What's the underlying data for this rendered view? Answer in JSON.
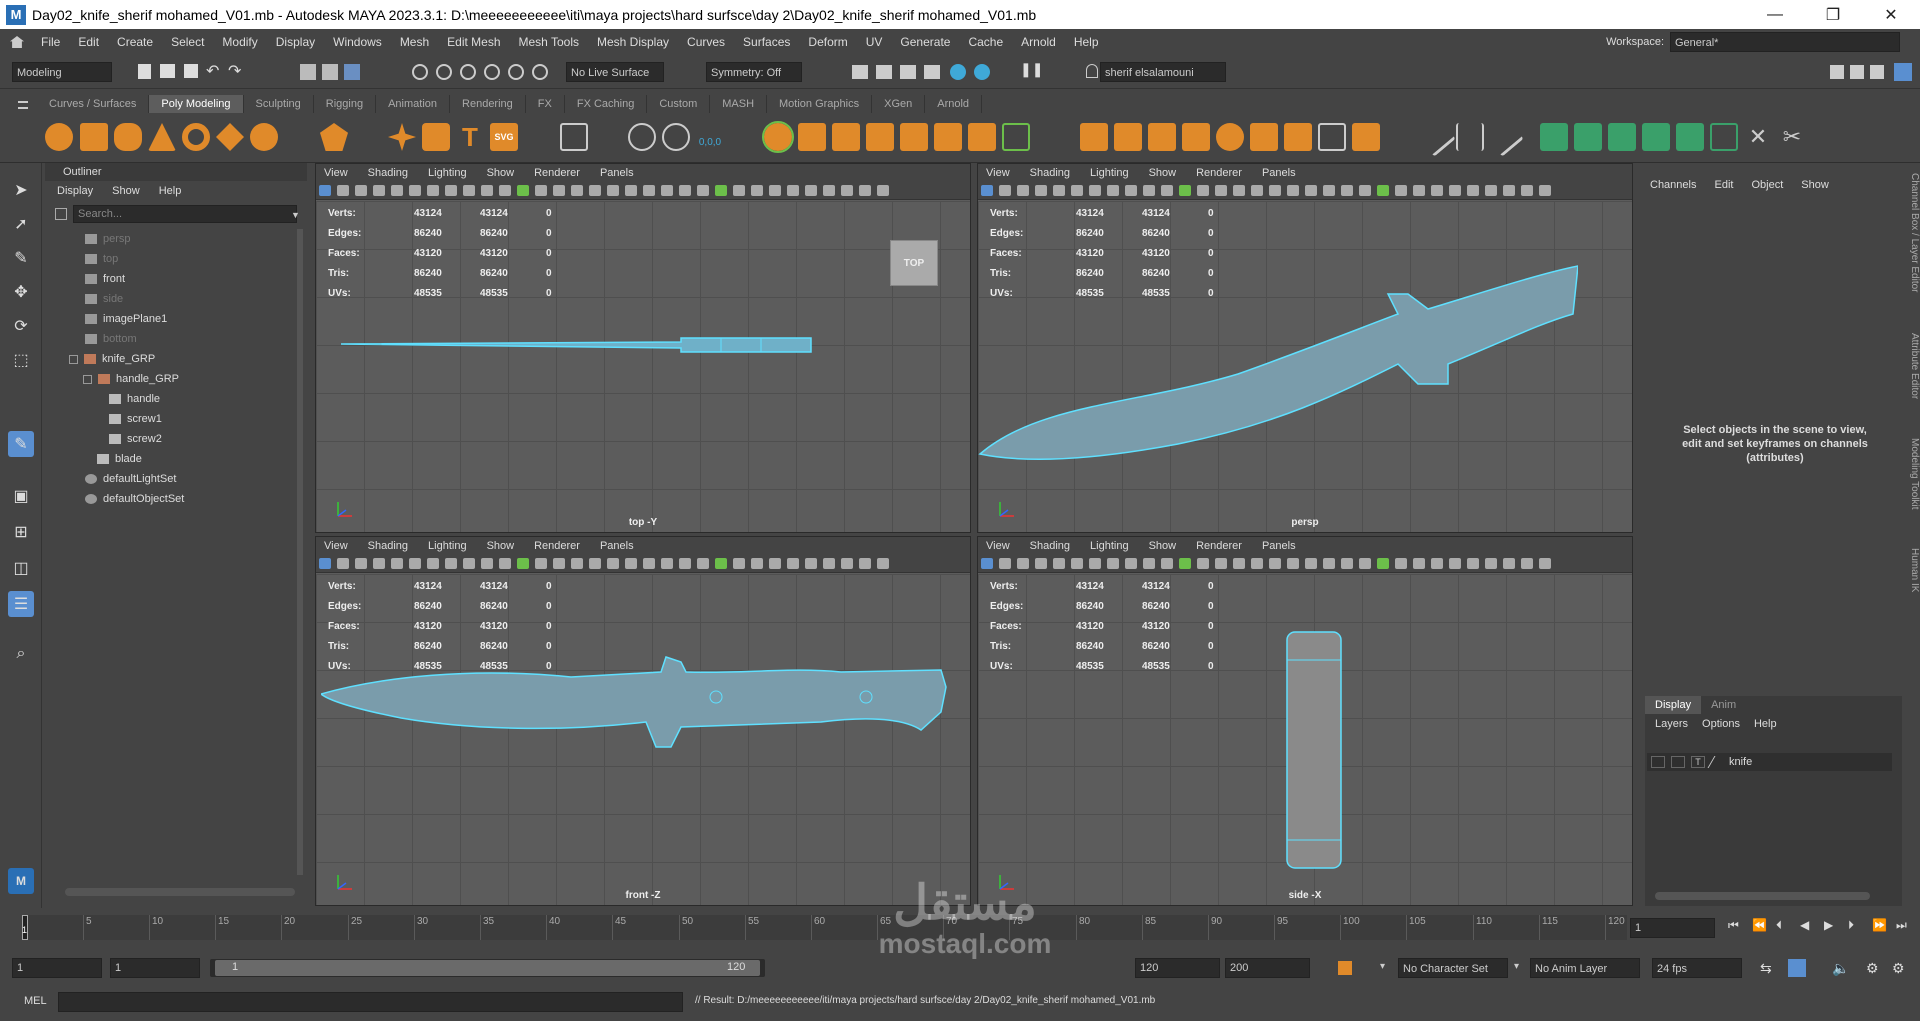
{
  "titlebar": {
    "app_icon": "M",
    "title": "Day02_knife_sherif mohamed_V01.mb - Autodesk MAYA 2023.3.1: D:\\meeeeeeeeeee\\iti\\maya projects\\hard surfsce\\day 2\\Day02_knife_sherif mohamed_V01.mb",
    "min": "—",
    "max": "❐",
    "close": "✕"
  },
  "menubar": {
    "items": [
      "File",
      "Edit",
      "Create",
      "Select",
      "Modify",
      "Display",
      "Windows",
      "Mesh",
      "Edit Mesh",
      "Mesh Tools",
      "Mesh Display",
      "Curves",
      "Surfaces",
      "Deform",
      "UV",
      "Generate",
      "Cache",
      "Arnold",
      "Help"
    ],
    "workspace_label": "Workspace:",
    "workspace_value": "General*"
  },
  "status": {
    "mode": "Modeling",
    "live_surface": "No Live Surface",
    "symmetry": "Symmetry: Off",
    "user": "sherif elsalamouni"
  },
  "shelf_tabs": [
    "Curves / Surfaces",
    "Poly Modeling",
    "Sculpting",
    "Rigging",
    "Animation",
    "Rendering",
    "FX",
    "FX Caching",
    "Custom",
    "MASH",
    "Motion Graphics",
    "XGen",
    "Arnold"
  ],
  "outliner": {
    "title": "Outliner",
    "menus": [
      "Display",
      "Show",
      "Help"
    ],
    "search_placeholder": "Search...",
    "items": [
      {
        "label": "persp",
        "dim": true
      },
      {
        "label": "top",
        "dim": true
      },
      {
        "label": "front",
        "dim": false
      },
      {
        "label": "side",
        "dim": true
      },
      {
        "label": "imagePlane1",
        "dim": false
      },
      {
        "label": "bottom",
        "dim": true
      },
      {
        "label": "knife_GRP",
        "dim": false
      },
      {
        "label": "handle_GRP",
        "dim": false
      },
      {
        "label": "handle",
        "dim": false
      },
      {
        "label": "screw1",
        "dim": false
      },
      {
        "label": "screw2",
        "dim": false
      },
      {
        "label": "blade",
        "dim": false
      },
      {
        "label": "defaultLightSet",
        "dim": false
      },
      {
        "label": "defaultObjectSet",
        "dim": false
      }
    ]
  },
  "viewport_menu": [
    "View",
    "Shading",
    "Lighting",
    "Show",
    "Renderer",
    "Panels"
  ],
  "hud": {
    "rows": [
      {
        "label": "Verts:",
        "a": "43124",
        "b": "43124",
        "c": "0"
      },
      {
        "label": "Edges:",
        "a": "86240",
        "b": "86240",
        "c": "0"
      },
      {
        "label": "Faces:",
        "a": "43120",
        "b": "43120",
        "c": "0"
      },
      {
        "label": "Tris:",
        "a": "86240",
        "b": "86240",
        "c": "0"
      },
      {
        "label": "UVs:",
        "a": "48535",
        "b": "48535",
        "c": "0"
      }
    ]
  },
  "viewports": {
    "top": {
      "camera": "top -Y",
      "cube_label": "TOP"
    },
    "persp": {
      "camera": "persp"
    },
    "front": {
      "camera": "front -Z"
    },
    "side": {
      "camera": "side -X"
    }
  },
  "channelbox": {
    "menus": [
      "Channels",
      "Edit",
      "Object",
      "Show"
    ],
    "empty_message": "Select objects in the scene to view, edit and set keyframes on channels (attributes)"
  },
  "layers": {
    "tabs": [
      "Display",
      "Anim"
    ],
    "menus": [
      "Layers",
      "Options",
      "Help"
    ],
    "layer_name": "knife",
    "layer_flag": "T"
  },
  "side_tabs": [
    "Channel Box / Layer Editor",
    "Attribute Editor",
    "Modeling Toolkit",
    "Human IK"
  ],
  "timeline": {
    "ticks": [
      "5",
      "10",
      "15",
      "20",
      "25",
      "30",
      "35",
      "40",
      "45",
      "50",
      "55",
      "60",
      "65",
      "70",
      "75",
      "80",
      "85",
      "90",
      "95",
      "100",
      "105",
      "110",
      "115",
      "120"
    ],
    "current_frame": "1",
    "playhead_marker": "1"
  },
  "range": {
    "start": "1",
    "anim_start": "1",
    "slider_start": "1",
    "slider_end": "120",
    "range_end": "120",
    "anim_end": "200",
    "character_set": "No Character Set",
    "anim_layer": "No Anim Layer",
    "fps": "24 fps"
  },
  "cmdline": {
    "lang": "MEL",
    "result": "// Result: D:/meeeeeeeeeee/iti/maya projects/hard surfsce/day 2/Day02_knife_sherif mohamed_V01.mb"
  },
  "watermark": {
    "line1": "مستقل",
    "line2": "mostaql.com"
  }
}
